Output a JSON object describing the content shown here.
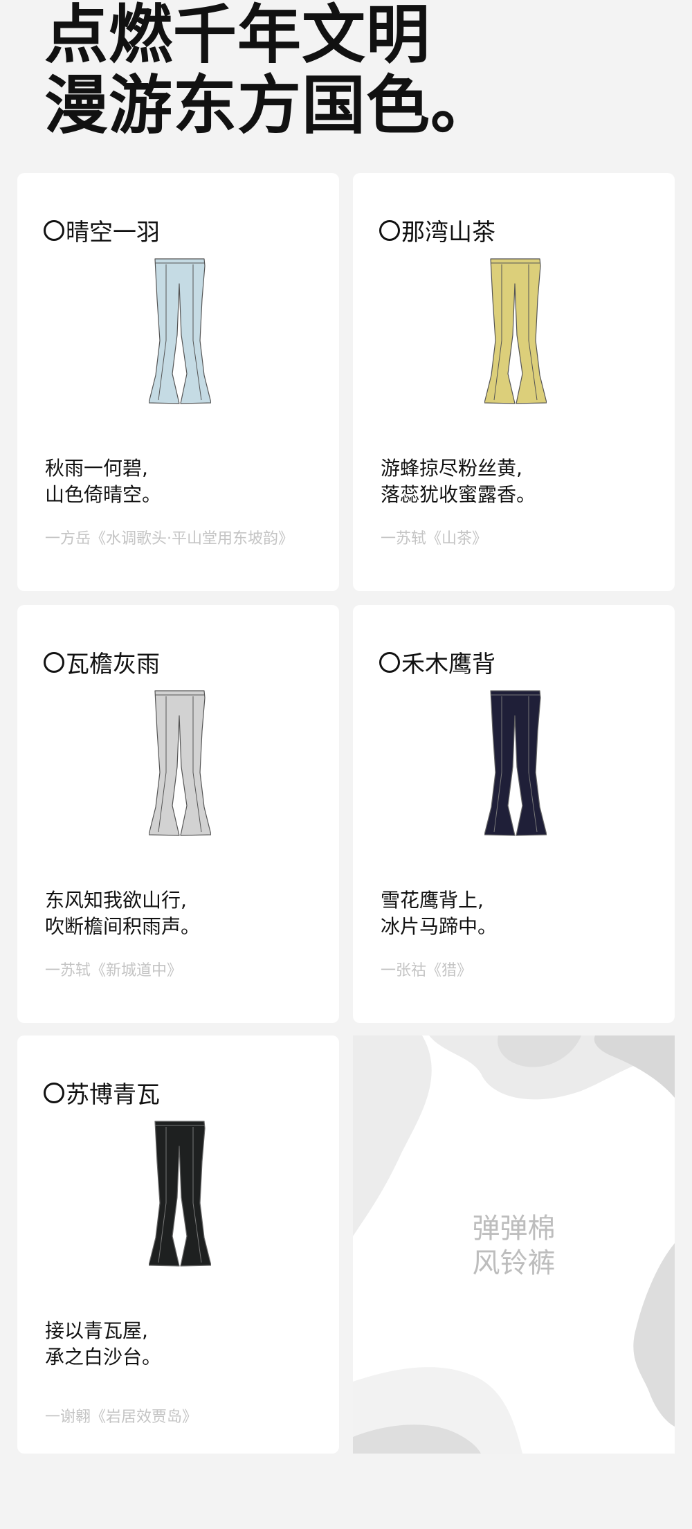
{
  "headline": {
    "line1": "点燃千年文明",
    "line2": "漫游东方国色。"
  },
  "cards": [
    {
      "name": "晴空一羽",
      "pants_color": "#c5dbe4",
      "poem_line1": "秋雨一何碧,",
      "poem_line2": "山色倚晴空。",
      "source": "一方岳《水调歌头·平山堂用东坡韵》"
    },
    {
      "name": "那湾山茶",
      "pants_color": "#dccf7a",
      "poem_line1": "游蜂掠尽粉丝黄,",
      "poem_line2": "落蕊犹收蜜露香。",
      "source": "一苏轼《山茶》"
    },
    {
      "name": "瓦檐灰雨",
      "pants_color": "#d2d2d2",
      "poem_line1": "东风知我欲山行,",
      "poem_line2": "吹断檐间积雨声。",
      "source": "一苏轼《新城道中》"
    },
    {
      "name": "禾木鹰背",
      "pants_color": "#1f1f38",
      "poem_line1": "雪花鹰背上,",
      "poem_line2": "冰片马蹄中。",
      "source": "一张祜《猎》"
    },
    {
      "name": "苏博青瓦",
      "pants_color": "#1e2020",
      "poem_line1": "接以青瓦屋,",
      "poem_line2": "承之白沙台。",
      "source": "一谢翱《岩居效贾岛》"
    }
  ],
  "promo": {
    "line1": "弹弹棉",
    "line2": "风铃裤"
  }
}
